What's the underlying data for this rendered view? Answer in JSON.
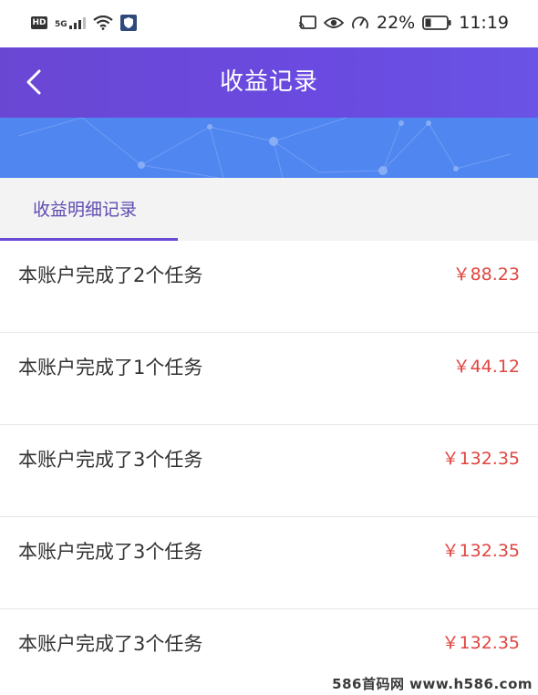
{
  "status_bar": {
    "hd": "HD",
    "network": "5G",
    "battery_percent": "22%",
    "time": "11:19"
  },
  "header": {
    "title": "收益记录",
    "back_icon": "chevron-left-icon"
  },
  "tabs": [
    {
      "label": "收益明细记录",
      "active": true
    }
  ],
  "records": [
    {
      "desc": "本账户完成了2个任务",
      "amount": "￥88.23"
    },
    {
      "desc": "本账户完成了1个任务",
      "amount": "￥44.12"
    },
    {
      "desc": "本账户完成了3个任务",
      "amount": "￥132.35"
    },
    {
      "desc": "本账户完成了3个任务",
      "amount": "￥132.35"
    },
    {
      "desc": "本账户完成了3个任务",
      "amount": "￥132.35"
    }
  ],
  "watermark": "586首码网 www.h586.com",
  "colors": {
    "header": "#6a4ae0",
    "banner": "#4f86f0",
    "accent": "#6a4bd6",
    "amount": "#e0453f"
  }
}
